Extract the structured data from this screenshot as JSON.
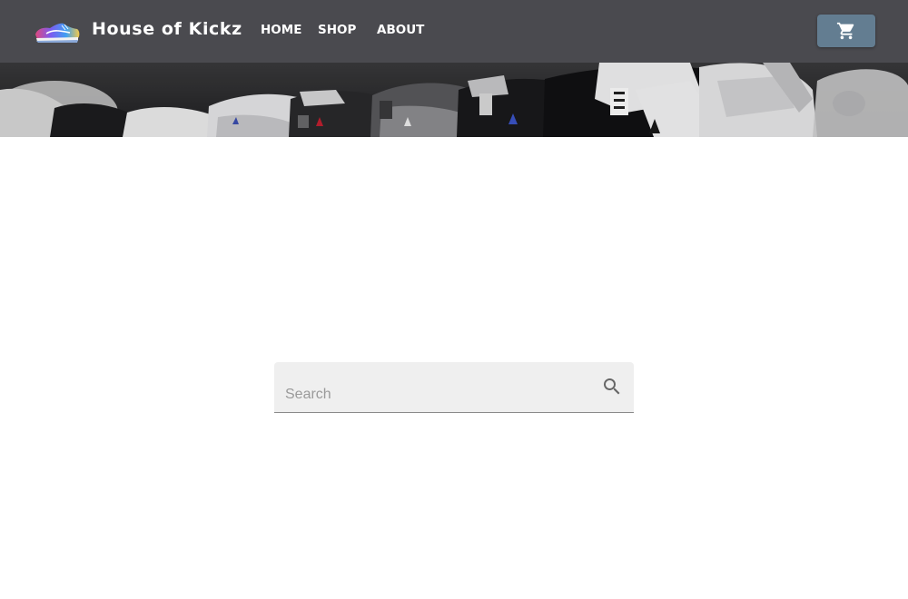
{
  "brand": {
    "name": "House of Kickz",
    "logo_icon": "sneaker-logo-icon"
  },
  "nav": {
    "items": [
      {
        "label": "HOME"
      },
      {
        "label": "SHOP"
      },
      {
        "label": "ABOUT"
      }
    ]
  },
  "cart": {
    "icon": "shopping-cart-icon",
    "button_color": "#637d91"
  },
  "banner": {
    "image": "sneaker-shelf-banner"
  },
  "search": {
    "placeholder": "Search",
    "value": "",
    "icon": "search-icon"
  },
  "colors": {
    "navbar": "#4a4a4f",
    "search_bg": "#efefef",
    "page_bg": "#ffffff"
  }
}
